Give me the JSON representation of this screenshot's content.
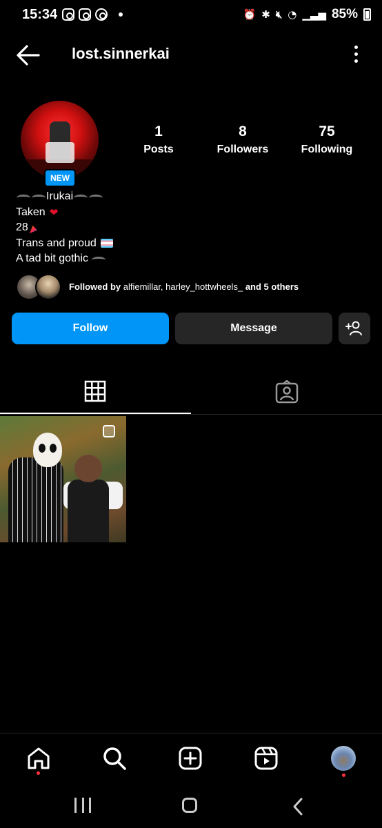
{
  "status_bar": {
    "time": "15:34",
    "battery": "85%"
  },
  "header": {
    "username": "lost.sinnerkai"
  },
  "profile": {
    "new_badge": "NEW",
    "stats": [
      {
        "value": "1",
        "label": "Posts"
      },
      {
        "value": "8",
        "label": "Followers"
      },
      {
        "value": "75",
        "label": "Following"
      }
    ],
    "bio": {
      "name": "Irukai",
      "line1": "Taken",
      "line2": "28",
      "line3": "Trans and proud",
      "line4": "A tad bit gothic"
    },
    "followed_by": {
      "prefix": "Followed by",
      "names": "alfiemillar, harley_hottwheels_",
      "suffix": "and 5 others"
    }
  },
  "actions": {
    "follow": "Follow",
    "message": "Message"
  },
  "colors": {
    "accent": "#0095f6",
    "button_dark": "#262626",
    "notification_dot": "#ff3040"
  },
  "icons": {
    "back": "arrow-left-icon",
    "more": "more-vertical-icon",
    "suggest": "add-person-icon",
    "grid_tab": "grid-icon",
    "tagged_tab": "tagged-person-icon",
    "home": "home-icon",
    "search": "search-icon",
    "create": "plus-square-icon",
    "reels": "reels-icon"
  }
}
